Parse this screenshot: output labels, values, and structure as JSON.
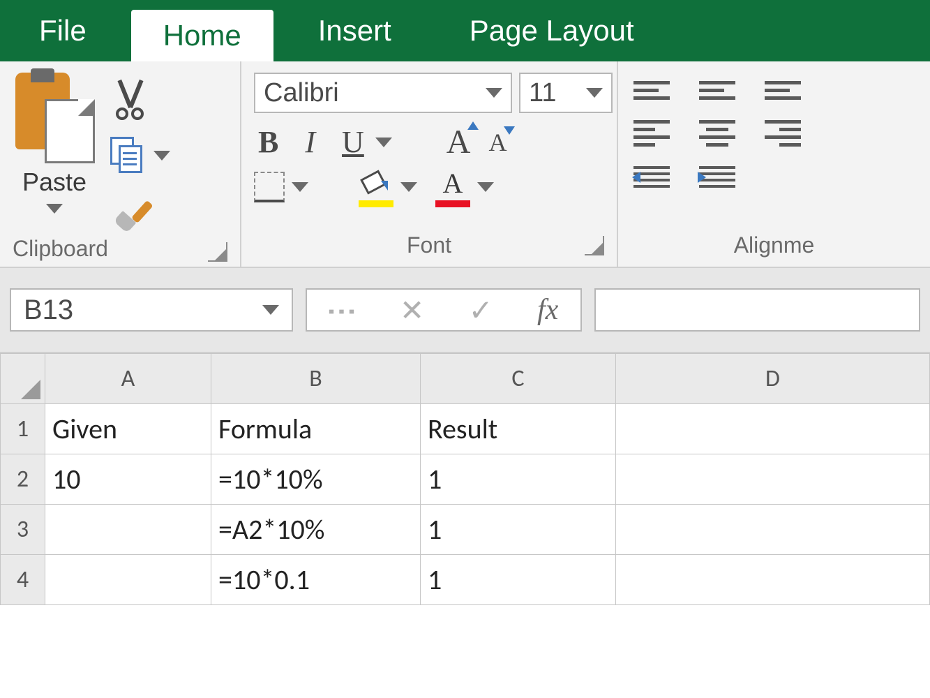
{
  "tabs": {
    "file": "File",
    "home": "Home",
    "insert": "Insert",
    "page_layout": "Page Layout"
  },
  "ribbon": {
    "clipboard": {
      "paste_label": "Paste",
      "group_label": "Clipboard"
    },
    "font": {
      "font_name": "Calibri",
      "font_size": "11",
      "bold": "B",
      "italic": "I",
      "underline": "U",
      "grow": "A",
      "shrink": "A",
      "fontcolor_char": "A",
      "group_label": "Font"
    },
    "alignment": {
      "group_label": "Alignme"
    }
  },
  "formula_bar": {
    "name_box": "B13",
    "fx_label": "fx",
    "formula_value": ""
  },
  "columns": [
    "A",
    "B",
    "C",
    "D"
  ],
  "rows": [
    {
      "n": "1",
      "A": "Given",
      "B": "Formula",
      "C": "Result",
      "D": ""
    },
    {
      "n": "2",
      "A": "10",
      "B": "=10*10%",
      "C": "1",
      "D": ""
    },
    {
      "n": "3",
      "A": "",
      "B": "=A2*10%",
      "C": "1",
      "D": ""
    },
    {
      "n": "4",
      "A": "",
      "B": "=10*0.1",
      "C": "1",
      "D": ""
    }
  ]
}
